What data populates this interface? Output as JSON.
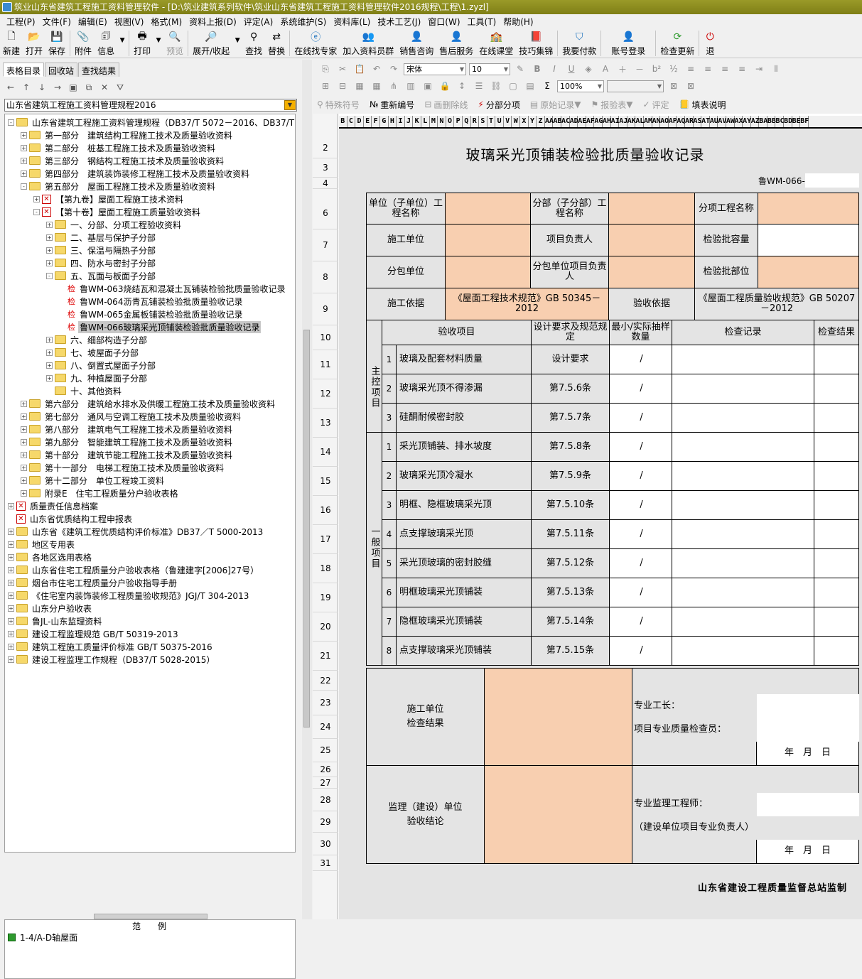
{
  "window": {
    "title": "筑业山东省建筑工程施工资料管理软件 - [D:\\筑业建筑系列软件\\筑业山东省建筑工程施工资料管理软件2016规程\\工程\\1.zyzl]"
  },
  "menu": [
    "工程(P)",
    "文件(F)",
    "编辑(E)",
    "视图(V)",
    "格式(M)",
    "资料上报(D)",
    "评定(A)",
    "系统维护(S)",
    "资料库(L)",
    "技术工艺(J)",
    "窗口(W)",
    "工具(T)",
    "帮助(H)"
  ],
  "toolbar": {
    "new": "新建",
    "open": "打开",
    "save": "保存",
    "attach": "附件",
    "info": "信息",
    "print": "打印",
    "preview": "预览",
    "expand": "展开/收起",
    "find": "查找",
    "replace": "替换",
    "expert": "在线找专家",
    "join": "加入资料员群",
    "sales": "销售咨询",
    "after": "售后服务",
    "class": "在线课堂",
    "tips": "技巧集锦",
    "pay": "我要付款",
    "login": "账号登录",
    "update": "检查更新",
    "exit": "退"
  },
  "left": {
    "tabs": [
      "表格目录",
      "回收站",
      "查找结果"
    ],
    "select": "山东省建筑工程施工资料管理规程2016",
    "tree": [
      {
        "d": 0,
        "e": "-",
        "i": "f",
        "t": "山东省建筑工程施工资料管理规程（DB37/T 5072－2016、DB37/T 5073"
      },
      {
        "d": 1,
        "e": "+",
        "i": "f",
        "t": "第一部分　建筑结构工程施工技术及质量验收资料"
      },
      {
        "d": 1,
        "e": "+",
        "i": "f",
        "t": "第二部分　桩基工程施工技术及质量验收资料"
      },
      {
        "d": 1,
        "e": "+",
        "i": "f",
        "t": "第三部分　钢结构工程施工技术及质量验收资料"
      },
      {
        "d": 1,
        "e": "+",
        "i": "f",
        "t": "第四部分　建筑装饰装修工程施工技术及质量验收资料"
      },
      {
        "d": 1,
        "e": "-",
        "i": "f",
        "t": "第五部分　屋面工程施工技术及质量验收资料"
      },
      {
        "d": 2,
        "e": "+",
        "i": "x",
        "t": "【第九卷】屋面工程施工技术资料"
      },
      {
        "d": 2,
        "e": "-",
        "i": "x",
        "t": "【第十卷】屋面工程施工质量验收资料"
      },
      {
        "d": 3,
        "e": "+",
        "i": "f",
        "t": "一、分部、分项工程验收资料"
      },
      {
        "d": 3,
        "e": "+",
        "i": "f",
        "t": "二、基层与保护子分部"
      },
      {
        "d": 3,
        "e": "+",
        "i": "f",
        "t": "三、保温与隔热子分部"
      },
      {
        "d": 3,
        "e": "+",
        "i": "f",
        "t": "四、防水与密封子分部"
      },
      {
        "d": 3,
        "e": "-",
        "i": "f",
        "t": "五、瓦面与板面子分部"
      },
      {
        "d": 4,
        "e": "",
        "i": "j",
        "t": "鲁WM-063烧结瓦和混凝土瓦铺装检验批质量验收记录"
      },
      {
        "d": 4,
        "e": "",
        "i": "j",
        "t": "鲁WM-064沥青瓦铺装检验批质量验收记录"
      },
      {
        "d": 4,
        "e": "",
        "i": "j",
        "t": "鲁WM-065金属板铺装检验批质量验收记录"
      },
      {
        "d": 4,
        "e": "",
        "i": "j",
        "t": "鲁WM-066玻璃采光顶铺装检验批质量验收记录",
        "sel": true
      },
      {
        "d": 3,
        "e": "+",
        "i": "f",
        "t": "六、细部构造子分部"
      },
      {
        "d": 3,
        "e": "+",
        "i": "f",
        "t": "七、坡屋面子分部"
      },
      {
        "d": 3,
        "e": "+",
        "i": "f",
        "t": "八、倒置式屋面子分部"
      },
      {
        "d": 3,
        "e": "+",
        "i": "f",
        "t": "九、种植屋面子分部"
      },
      {
        "d": 3,
        "e": "",
        "i": "f",
        "t": "十、其他资料"
      },
      {
        "d": 1,
        "e": "+",
        "i": "f",
        "t": "第六部分　建筑给水排水及供暖工程施工技术及质量验收资料"
      },
      {
        "d": 1,
        "e": "+",
        "i": "f",
        "t": "第七部分　通风与空调工程施工技术及质量验收资料"
      },
      {
        "d": 1,
        "e": "+",
        "i": "f",
        "t": "第八部分　建筑电气工程施工技术及质量验收资料"
      },
      {
        "d": 1,
        "e": "+",
        "i": "f",
        "t": "第九部分　智能建筑工程施工技术及质量验收资料"
      },
      {
        "d": 1,
        "e": "+",
        "i": "f",
        "t": "第十部分　建筑节能工程施工技术及质量验收资料"
      },
      {
        "d": 1,
        "e": "+",
        "i": "f",
        "t": "第十一部分　电梯工程施工技术及质量验收资料"
      },
      {
        "d": 1,
        "e": "+",
        "i": "f",
        "t": "第十二部分　单位工程竣工资料"
      },
      {
        "d": 1,
        "e": "+",
        "i": "f",
        "t": "附录E　住宅工程质量分户验收表格"
      },
      {
        "d": 0,
        "e": "+",
        "i": "x",
        "t": "质量责任信息档案"
      },
      {
        "d": 0,
        "e": "",
        "i": "x",
        "t": "山东省优质结构工程申报表"
      },
      {
        "d": 0,
        "e": "+",
        "i": "f",
        "t": "山东省《建筑工程优质结构评价标准》DB37／T 5000-2013"
      },
      {
        "d": 0,
        "e": "+",
        "i": "f",
        "t": "地区专用表"
      },
      {
        "d": 0,
        "e": "+",
        "i": "f",
        "t": "各地区选用表格"
      },
      {
        "d": 0,
        "e": "+",
        "i": "f",
        "t": "山东省住宅工程质量分户验收表格（鲁建建字[2006]27号）"
      },
      {
        "d": 0,
        "e": "+",
        "i": "f",
        "t": "烟台市住宅工程质量分户验收指导手册"
      },
      {
        "d": 0,
        "e": "+",
        "i": "f",
        "t": "《住宅室内装饰装修工程质量验收规范》JGJ/T 304-2013"
      },
      {
        "d": 0,
        "e": "+",
        "i": "f",
        "t": "山东分户验收表"
      },
      {
        "d": 0,
        "e": "+",
        "i": "f",
        "t": "鲁JL-山东监理资料"
      },
      {
        "d": 0,
        "e": "+",
        "i": "f",
        "t": "建设工程监理规范 GB/T 50319-2013"
      },
      {
        "d": 0,
        "e": "+",
        "i": "f",
        "t": "建筑工程施工质量评价标准 GB/T 50375-2016"
      },
      {
        "d": 0,
        "e": "+",
        "i": "f",
        "t": "建设工程监理工作规程（DB37/T 5028-2015）"
      }
    ],
    "legend_title": "范例",
    "legend_item": "1-4/A-D轴屋面"
  },
  "right_toolbar": {
    "font": "宋体",
    "size": "10",
    "zoom": "100%",
    "special": "特殊符号",
    "renumber": "重新编号",
    "delete_line": "画删除线",
    "subpart": "分部分项",
    "original": "原始记录",
    "report": "报验表",
    "evaluate": "评定",
    "fill_help": "填表说明"
  },
  "columns": "BCDEFGHIJKLMNOPQRSTUVWXYZAAABACADAEAFAGAHAIAJAKALAMANAOAPAQARASATAUAVAWAXAYAZBABBBCBDBEBF",
  "rows": [
    "2",
    "3",
    "4",
    "6",
    "7",
    "8",
    "9",
    "10",
    "11",
    "12",
    "13",
    "14",
    "15",
    "16",
    "17",
    "18",
    "19",
    "20",
    "21",
    "22",
    "23",
    "24",
    "25",
    "26",
    "27",
    "28",
    "29",
    "30",
    "31"
  ],
  "form": {
    "title": "玻璃采光顶铺装检验批质量验收记录",
    "code": "鲁WM-066-",
    "unit_label": "单位（子单位）工程名称",
    "division_label": "分部（子分部）工程名称",
    "item_label": "分项工程名称",
    "constructor_label": "施工单位",
    "pm_label": "项目负责人",
    "capacity_label": "检验批容量",
    "subcontractor_label": "分包单位",
    "sub_pm_label": "分包单位项目负责人",
    "location_label": "检验批部位",
    "basis_label": "施工依据",
    "basis_value": "《屋面工程技术规范》GB 50345－2012",
    "accept_basis_label": "验收依据",
    "accept_basis_value": "《屋面工程质量验收规范》GB 50207－2012",
    "h_item": "验收项目",
    "h_req": "设计要求及规范规定",
    "h_qty": "最小/实际抽样数量",
    "h_record": "检查记录",
    "h_result": "检查结果",
    "main_label": "主控项目",
    "general_label": "一般项目",
    "main_items": [
      {
        "n": "1",
        "name": "玻璃及配套材料质量",
        "req": "设计要求",
        "slash": "/"
      },
      {
        "n": "2",
        "name": "玻璃采光顶不得渗漏",
        "req": "第7.5.6条",
        "slash": "/"
      },
      {
        "n": "3",
        "name": "硅酮耐候密封胶",
        "req": "第7.5.7条",
        "slash": "/"
      }
    ],
    "general_items": [
      {
        "n": "1",
        "name": "采光顶铺装、排水坡度",
        "req": "第7.5.8条",
        "slash": "/"
      },
      {
        "n": "2",
        "name": "玻璃采光顶冷凝水",
        "req": "第7.5.9条",
        "slash": "/"
      },
      {
        "n": "3",
        "name": "明框、隐框玻璃采光顶",
        "req": "第7.5.10条",
        "slash": "/"
      },
      {
        "n": "4",
        "name": "点支撑玻璃采光顶",
        "req": "第7.5.11条",
        "slash": "/"
      },
      {
        "n": "5",
        "name": "采光顶玻璃的密封胶缝",
        "req": "第7.5.12条",
        "slash": "/"
      },
      {
        "n": "6",
        "name": "明框玻璃采光顶铺装",
        "req": "第7.5.13条",
        "slash": "/"
      },
      {
        "n": "7",
        "name": "隐框玻璃采光顶铺装",
        "req": "第7.5.14条",
        "slash": "/"
      },
      {
        "n": "8",
        "name": "点支撑玻璃采光顶铺装",
        "req": "第7.5.15条",
        "slash": "/"
      }
    ],
    "check_label_1": "施工单位",
    "check_label_2": "检查结果",
    "foreman": "专业工长：",
    "inspector": "项目专业质量检查员：",
    "date": "年　月　日",
    "sup_label_1": "监理（建设）单位",
    "sup_label_2": "验收结论",
    "sup_engineer": "专业监理工程师：",
    "sup_note": "（建设单位项目专业负责人）",
    "footer": "山东省建设工程质量监督总站监制"
  }
}
